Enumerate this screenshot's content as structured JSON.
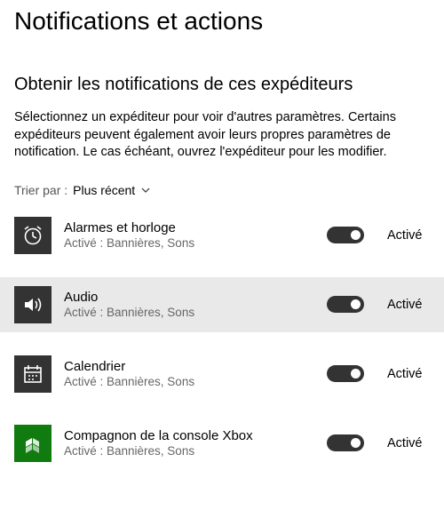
{
  "page_title": "Notifications et actions",
  "section_title": "Obtenir les notifications de ces expéditeurs",
  "description": "Sélectionnez un expéditeur pour voir d'autres paramètres. Certains expéditeurs peuvent également avoir leurs propres paramètres de notification. Le cas échéant, ouvrez l'expéditeur pour les modifier.",
  "sort": {
    "label": "Trier par :",
    "value": "Plus récent"
  },
  "toggle_on_label": "Activé",
  "senders": [
    {
      "name": "Alarmes et horloge",
      "sub": "Activé : Bannières, Sons",
      "icon": "alarm-icon",
      "selected": false,
      "bg": "dark"
    },
    {
      "name": "Audio",
      "sub": "Activé : Bannières, Sons",
      "icon": "speaker-icon",
      "selected": true,
      "bg": "dark"
    },
    {
      "name": "Calendrier",
      "sub": "Activé : Bannières, Sons",
      "icon": "calendar-icon",
      "selected": false,
      "bg": "dark"
    },
    {
      "name": "Compagnon de la console Xbox",
      "sub": "Activé : Bannières, Sons",
      "icon": "xbox-icon",
      "selected": false,
      "bg": "green"
    }
  ]
}
